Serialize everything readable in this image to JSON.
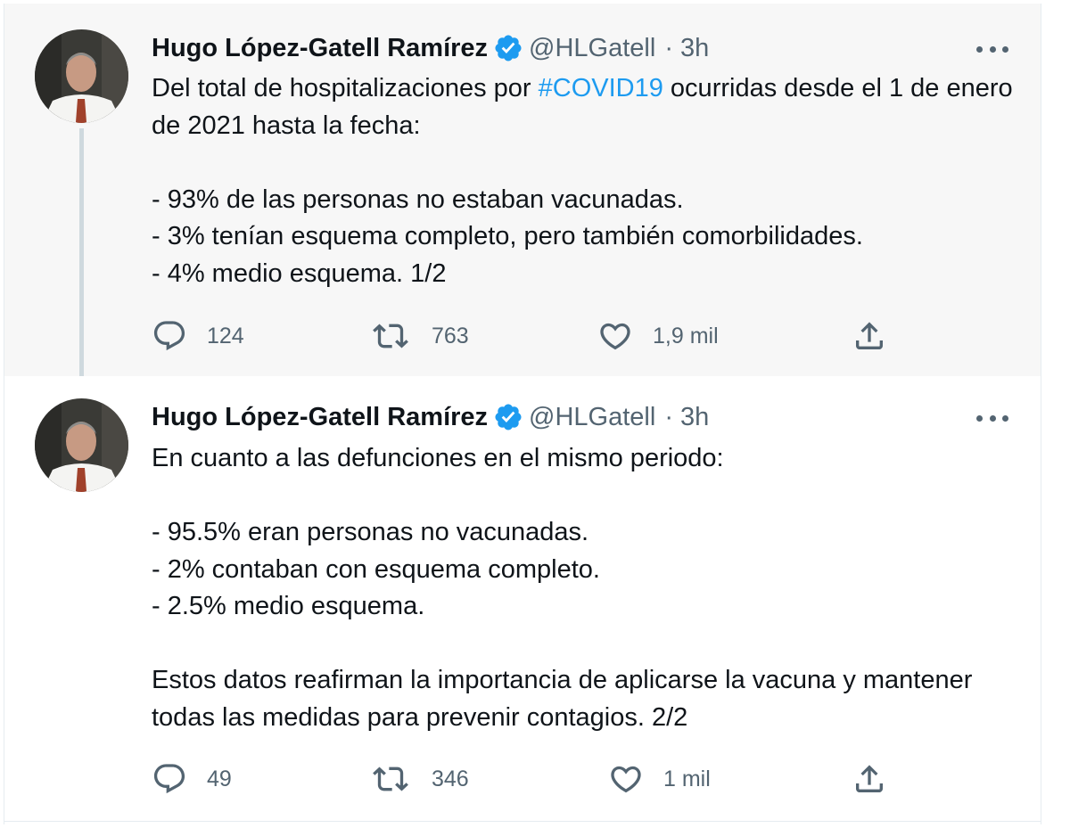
{
  "tweets": [
    {
      "author_name": "Hugo López-Gatell Ramírez",
      "handle": "@HLGatell",
      "separator": "·",
      "time": "3h",
      "text": {
        "line1_before": "Del total de hospitalizaciones por ",
        "hashtag": "#COVID19",
        "line1_after": " ocurridas desde el 1 de enero de 2021 hasta la fecha:",
        "p2": "- 93% de las personas no estaban vacunadas.\n- 3% tenían esquema completo, pero también comorbilidades.\n- 4% medio esquema. 1/2"
      },
      "actions": {
        "replies": "124",
        "retweets": "763",
        "likes": "1,9 mil"
      }
    },
    {
      "author_name": "Hugo López-Gatell Ramírez",
      "handle": "@HLGatell",
      "separator": "·",
      "time": "3h",
      "text": {
        "p1": "En cuanto a las defunciones en el mismo periodo:",
        "p2": "- 95.5% eran personas no vacunadas.\n- 2% contaban con esquema completo.\n- 2.5% medio esquema.",
        "p3": "Estos datos reafirman la importancia de aplicarse la vacuna y mantener todas las medidas para prevenir contagios. 2/2"
      },
      "actions": {
        "replies": "49",
        "retweets": "346",
        "likes": "1 mil"
      }
    }
  ],
  "icons": {
    "verified": "verified-badge-icon",
    "more": "more-horizontal-icon",
    "reply": "reply-icon",
    "retweet": "retweet-icon",
    "like": "heart-icon",
    "share": "share-icon"
  },
  "colors": {
    "accent": "#1d9bf0",
    "muted": "#536471",
    "text": "#0f1419",
    "thread_bg": "#f7f7f7"
  }
}
